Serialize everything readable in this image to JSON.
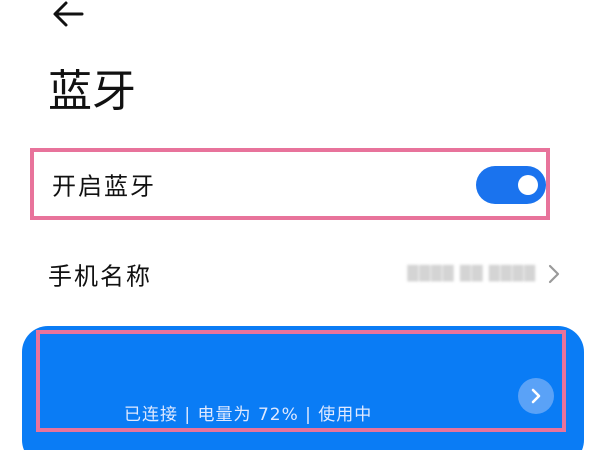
{
  "header": {
    "back_icon": "arrow-left-icon",
    "title": "蓝牙"
  },
  "bluetooth_toggle": {
    "label": "开启蓝牙",
    "enabled": true,
    "accent_color": "#1a73ee"
  },
  "device_name": {
    "label": "手机名称",
    "value": "████ ██ ████",
    "chevron_icon": "chevron-right-icon"
  },
  "device_card": {
    "status": "已连接 | 电量为 72% | 使用中",
    "battery_percent": 72,
    "background_color": "#0a7cf5",
    "arrow_icon": "chevron-right-circle-icon"
  },
  "highlight_color": "#e8739b"
}
